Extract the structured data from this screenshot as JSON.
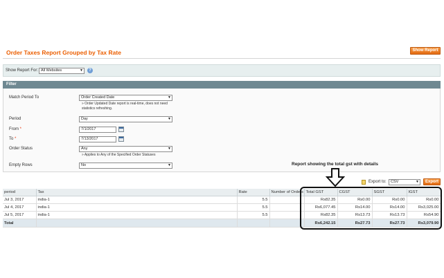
{
  "header": {
    "title": "Order Taxes Report Grouped by Tax Rate",
    "show_report_label": "Show Report"
  },
  "store": {
    "label": "Show Report For:",
    "selected": "All Websites",
    "help_icon": "question-icon"
  },
  "filter": {
    "title": "Filter",
    "match_period": {
      "label": "Match Period To",
      "value": "Order Created Date",
      "note": [
        "Order Updated Date report is real-time, does not need",
        "statistics refreshing."
      ]
    },
    "period": {
      "label": "Period",
      "value": "Day"
    },
    "from": {
      "label": "From",
      "required_mark": "*",
      "value": "7/1/2017"
    },
    "to": {
      "label": "To",
      "required_mark": "*",
      "value": "7/13/2017"
    },
    "order_status": {
      "label": "Order Status",
      "value": "Any",
      "note": "Applies to Any of the Specified Order Statuses"
    },
    "empty_rows": {
      "label": "Empty Rows",
      "value": "No"
    }
  },
  "annotation": {
    "text": "Report showing the total gst with details"
  },
  "export": {
    "label": "Export to:",
    "selected": "CSV",
    "button": "Export"
  },
  "table": {
    "headers": [
      "period",
      "Tax",
      "Rate",
      "Number of Orders",
      "Total GST",
      "CGST",
      "SGST",
      "IGST"
    ],
    "rows": [
      [
        "Jul 3, 2017",
        "india-1",
        "5.5",
        "",
        "Rs82.35",
        "Rs0.00",
        "Rs0.00",
        "Rs0.00"
      ],
      [
        "Jul 4, 2017",
        "india-1",
        "5.5",
        "",
        "Rs6,077.45",
        "Rs14.00",
        "Rs14.00",
        "Rs3,025.00"
      ],
      [
        "Jul 5, 2017",
        "india-1",
        "5.5",
        "",
        "Rs82.35",
        "Rs13.73",
        "Rs13.73",
        "Rs54.90"
      ]
    ],
    "total": [
      "Total",
      "",
      "",
      "",
      "Rs6,242.15",
      "Rs27.73",
      "Rs27.73",
      "Rs3,079.90"
    ]
  }
}
